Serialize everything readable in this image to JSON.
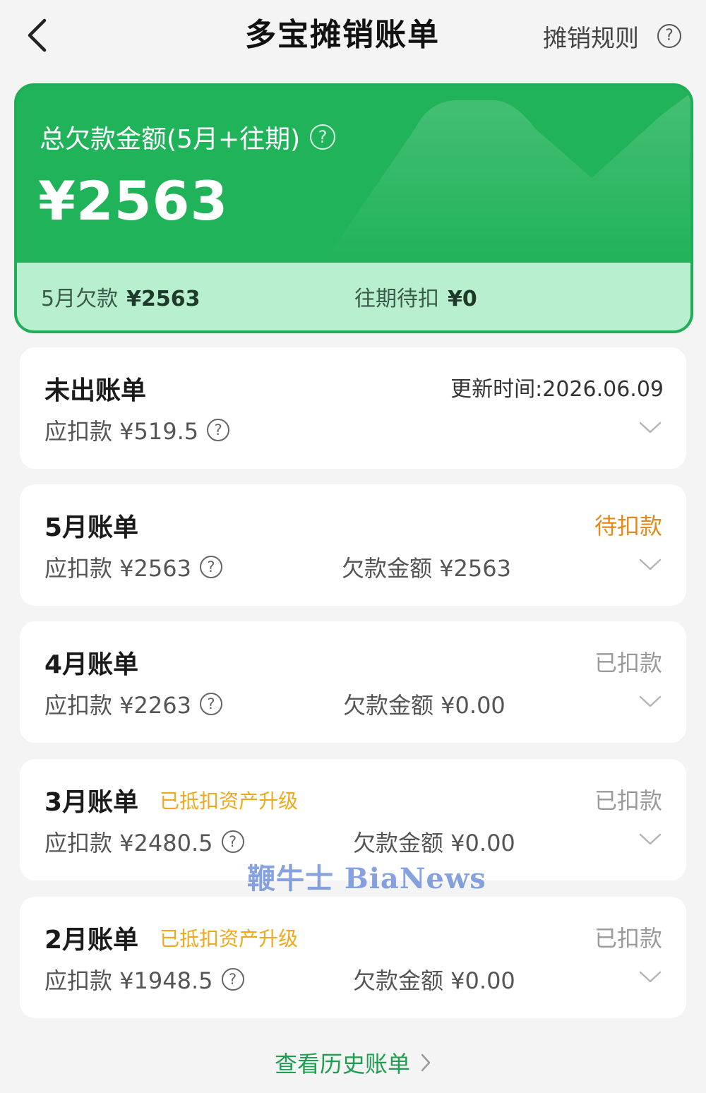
{
  "header": {
    "title": "多宝摊销账单",
    "rules_label": "摊销规则"
  },
  "summary": {
    "label": "总欠款金额(5月+往期)",
    "amount": "¥2563",
    "may_label": "5月欠款",
    "may_value": "¥2563",
    "past_label": "往期待扣",
    "past_value": "¥0"
  },
  "bills": [
    {
      "title": "未出账单",
      "status": "更新时间:2026.06.09",
      "due": "应扣款 ¥519.5"
    },
    {
      "title": "5月账单",
      "status": "待扣款",
      "due": "应扣款 ¥2563",
      "owed": "欠款金额 ¥2563"
    },
    {
      "title": "4月账单",
      "status": "已扣款",
      "due": "应扣款 ¥2263",
      "owed": "欠款金额 ¥0.00"
    },
    {
      "title": "3月账单",
      "tag": "已抵扣资产升级",
      "status": "已扣款",
      "due": "应扣款 ¥2480.5",
      "owed": "欠款金额 ¥0.00"
    },
    {
      "title": "2月账单",
      "tag": "已抵扣资产升级",
      "status": "已扣款",
      "due": "应扣款 ¥1948.5",
      "owed": "欠款金额 ¥0.00"
    }
  ],
  "watermark": "鞭牛士 BiaNews",
  "history_link": "查看历史账单",
  "colors": {
    "brand_green": "#21b35a",
    "strip_green": "#b8efcf",
    "pending_orange": "#e4891b",
    "tag_yellow": "#f0a81c",
    "link_green": "#1f9e52"
  },
  "icons": {
    "back": "chevron-left-icon",
    "help": "question-circle-icon",
    "expand": "chevron-down-icon",
    "more": "chevron-right-icon"
  }
}
